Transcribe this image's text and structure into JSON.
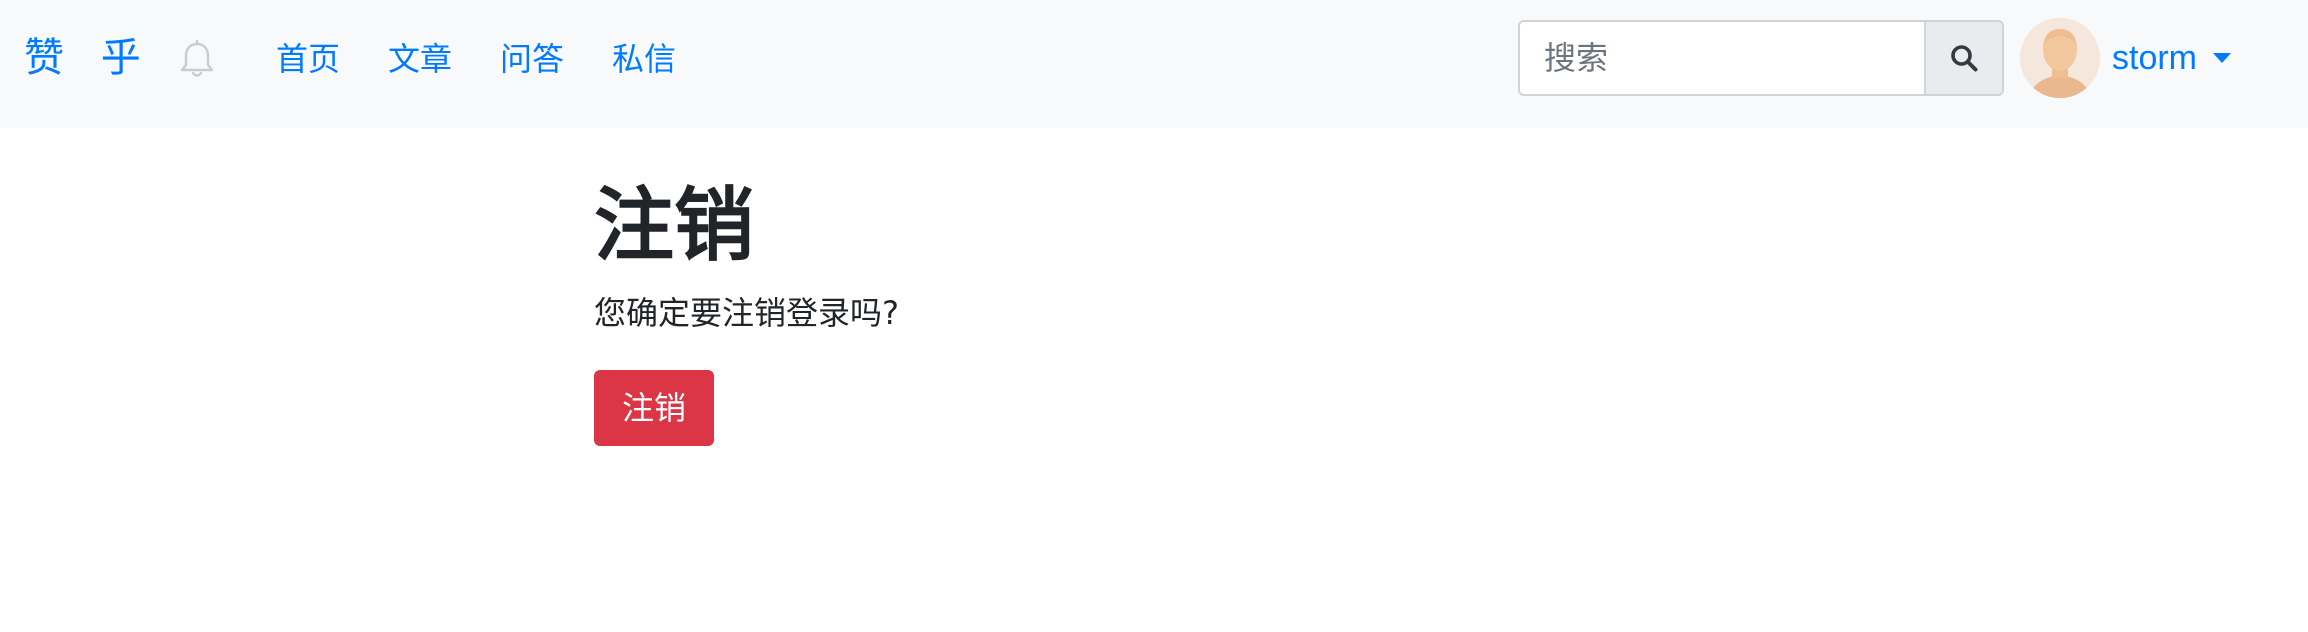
{
  "navbar": {
    "brand": "赞 乎",
    "bell_icon": "bell-icon",
    "links": [
      {
        "label": "首页"
      },
      {
        "label": "文章"
      },
      {
        "label": "问答"
      },
      {
        "label": "私信"
      }
    ],
    "search": {
      "placeholder": "搜索",
      "value": "",
      "button_icon": "search-icon"
    },
    "user": {
      "name": "storm",
      "avatar_icon": "avatar-icon",
      "dropdown_icon": "caret-down-icon"
    }
  },
  "main": {
    "title": "注销",
    "confirm_text": "您确定要注销登录吗?",
    "logout_button": "注销"
  },
  "colors": {
    "navbar_bg": "#f8f9fa",
    "link": "#007bff",
    "danger": "#dc3545",
    "text": "#212529"
  }
}
